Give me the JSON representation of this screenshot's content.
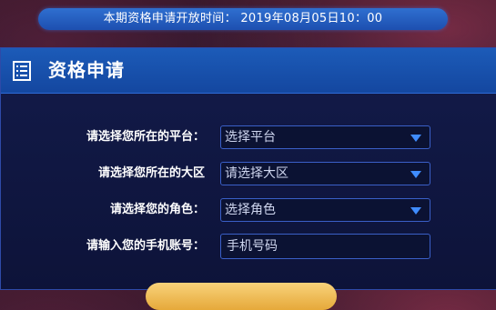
{
  "notice": {
    "text": "本期资格申请开放时间： 2019年08月05日10：00"
  },
  "panel": {
    "title": "资格申请",
    "icon": "document-icon"
  },
  "form": {
    "platform": {
      "label": "请选择您所在的平台：",
      "value": "选择平台"
    },
    "region": {
      "label": "请选择您所在的大区",
      "value": "请选择大区"
    },
    "role": {
      "label": "请选择您的角色：",
      "value": "选择角色"
    },
    "phone": {
      "label": "请输入您的手机账号：",
      "placeholder": "手机号码"
    }
  },
  "colors": {
    "accent": "#1d4fb0",
    "field_border": "#3a5fc7",
    "caret": "#3f8cff",
    "button": "#e6a93a"
  }
}
